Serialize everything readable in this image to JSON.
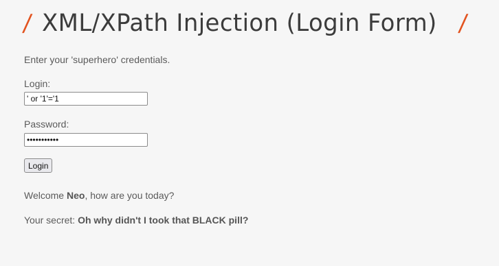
{
  "header": {
    "title": "XML/XPath Injection (Login Form)",
    "slash_left": "/",
    "slash_right": "/",
    "accent_color": "#e2531f"
  },
  "form": {
    "instruction": "Enter your 'superhero' credentials.",
    "login_label": "Login:",
    "login_value": "' or '1'='1",
    "password_label": "Password:",
    "password_value": "aaaaaaaaaaa",
    "submit_label": "Login"
  },
  "result": {
    "welcome_prefix": "Welcome ",
    "user_name": "Neo",
    "welcome_suffix": ", how are you today?",
    "secret_prefix": "Your secret: ",
    "secret_value": "Oh why didn't I took that BLACK pill?"
  }
}
